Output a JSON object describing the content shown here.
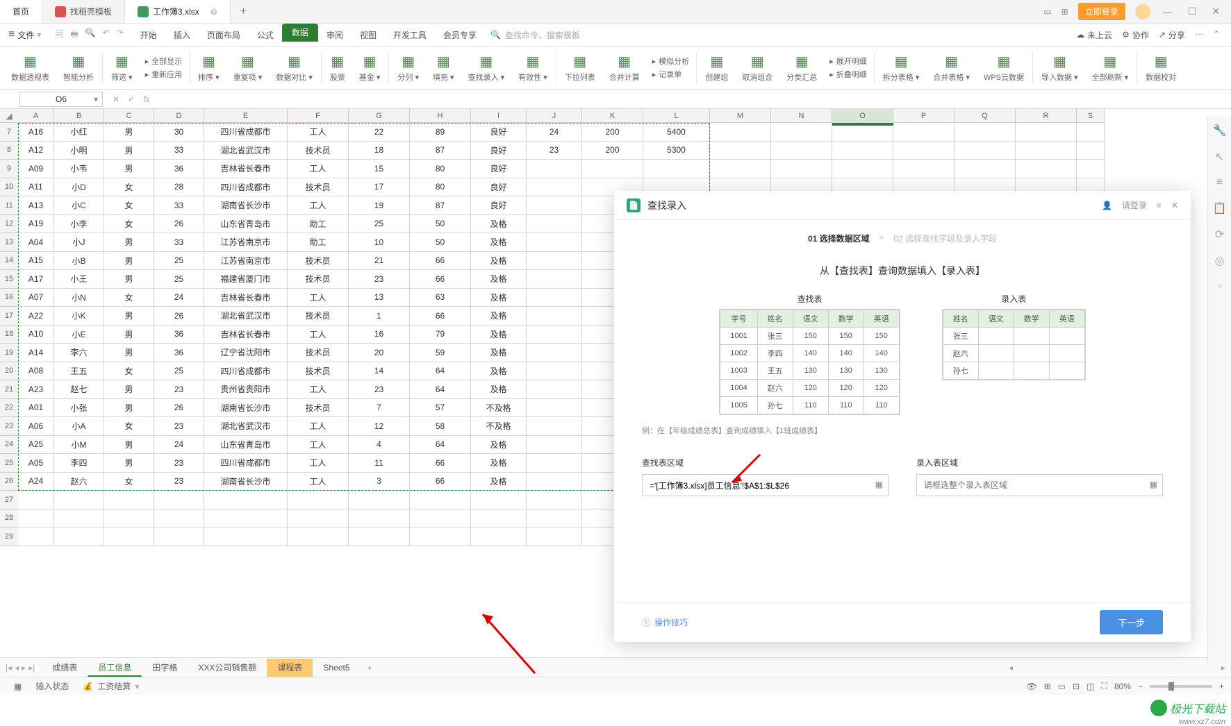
{
  "titlebar": {
    "home": "首页",
    "template": "找稻壳模板",
    "file_tab": "工作簿3.xlsx",
    "login": "立即登录"
  },
  "menubar": {
    "file": "文件",
    "items": [
      "开始",
      "插入",
      "页面布局",
      "公式",
      "数据",
      "审阅",
      "视图",
      "开发工具",
      "会员专享"
    ],
    "active_index": 4,
    "search_placeholder": "查找命令、搜索模板",
    "cloud": "未上云",
    "collab": "协作",
    "share": "分享"
  },
  "ribbon": {
    "groups": [
      "数据透视表",
      "智能分析",
      "筛选",
      "全部显示",
      "重新应用",
      "排序",
      "重复项",
      "数据对比",
      "股票",
      "基金",
      "分列",
      "填充",
      "查找录入",
      "有效性",
      "下拉列表",
      "合并计算",
      "模拟分析",
      "记录单",
      "创建组",
      "取消组合",
      "分类汇总",
      "展开明细",
      "折叠明细",
      "拆分表格",
      "合并表格",
      "WPS云数据",
      "导入数据",
      "全部刷新",
      "数据校对"
    ]
  },
  "formula": {
    "name_box": "O6",
    "fx": "fx"
  },
  "columns": [
    "A",
    "B",
    "C",
    "D",
    "E",
    "F",
    "G",
    "H",
    "I",
    "J",
    "K",
    "L",
    "M",
    "N",
    "O",
    "P",
    "Q",
    "R",
    "S"
  ],
  "row_start": 7,
  "rows": [
    [
      "A16",
      "小红",
      "男",
      "30",
      "四川省成都市",
      "工人",
      "22",
      "89",
      "良好",
      "24",
      "200",
      "5400"
    ],
    [
      "A12",
      "小明",
      "男",
      "33",
      "湖北省武汉市",
      "技术员",
      "18",
      "87",
      "良好",
      "23",
      "200",
      "5300"
    ],
    [
      "A09",
      "小韦",
      "男",
      "36",
      "吉林省长春市",
      "工人",
      "15",
      "80",
      "良好",
      "",
      "",
      ""
    ],
    [
      "A11",
      "小D",
      "女",
      "28",
      "四川省成都市",
      "技术员",
      "17",
      "80",
      "良好",
      "",
      "",
      ""
    ],
    [
      "A13",
      "小C",
      "女",
      "33",
      "湖南省长沙市",
      "工人",
      "19",
      "87",
      "良好",
      "",
      "",
      ""
    ],
    [
      "A19",
      "小李",
      "女",
      "26",
      "山东省青岛市",
      "助工",
      "25",
      "50",
      "及格",
      "",
      "",
      ""
    ],
    [
      "A04",
      "小J",
      "男",
      "33",
      "江苏省南京市",
      "助工",
      "10",
      "50",
      "及格",
      "",
      "",
      ""
    ],
    [
      "A15",
      "小B",
      "男",
      "25",
      "江苏省南京市",
      "技术员",
      "21",
      "66",
      "及格",
      "",
      "",
      ""
    ],
    [
      "A17",
      "小王",
      "男",
      "25",
      "福建省厦门市",
      "技术员",
      "23",
      "66",
      "及格",
      "",
      "",
      ""
    ],
    [
      "A07",
      "小N",
      "女",
      "24",
      "吉林省长春市",
      "工人",
      "13",
      "63",
      "及格",
      "",
      "",
      ""
    ],
    [
      "A22",
      "小K",
      "男",
      "26",
      "湖北省武汉市",
      "技术员",
      "1",
      "66",
      "及格",
      "",
      "",
      ""
    ],
    [
      "A10",
      "小E",
      "男",
      "36",
      "吉林省长春市",
      "工人",
      "16",
      "79",
      "及格",
      "",
      "",
      ""
    ],
    [
      "A14",
      "李六",
      "男",
      "36",
      "辽宁省沈阳市",
      "技术员",
      "20",
      "59",
      "及格",
      "",
      "",
      ""
    ],
    [
      "A08",
      "王五",
      "女",
      "25",
      "四川省成都市",
      "技术员",
      "14",
      "64",
      "及格",
      "",
      "",
      ""
    ],
    [
      "A23",
      "赵七",
      "男",
      "23",
      "贵州省贵阳市",
      "工人",
      "23",
      "64",
      "及格",
      "",
      "",
      ""
    ],
    [
      "A01",
      "小张",
      "男",
      "26",
      "湖南省长沙市",
      "技术员",
      "7",
      "57",
      "不及格",
      "",
      "",
      ""
    ],
    [
      "A06",
      "小A",
      "女",
      "23",
      "湖北省武汉市",
      "工人",
      "12",
      "58",
      "不及格",
      "",
      "",
      ""
    ],
    [
      "A25",
      "小M",
      "男",
      "24",
      "山东省青岛市",
      "工人",
      "4",
      "64",
      "及格",
      "",
      "",
      ""
    ],
    [
      "A05",
      "李四",
      "男",
      "23",
      "四川省成都市",
      "工人",
      "11",
      "66",
      "及格",
      "",
      "",
      ""
    ],
    [
      "A24",
      "赵六",
      "女",
      "23",
      "湖南省长沙市",
      "工人",
      "3",
      "66",
      "及格",
      "",
      "",
      ""
    ]
  ],
  "panel": {
    "title": "查找录入",
    "login_prompt": "请登录",
    "step1": "01 选择数据区域",
    "step2": "02 选择查找字段及录入字段",
    "diagram_title": "从【查找表】查询数据填入【录入表】",
    "lookup_table_title": "查找表",
    "entry_table_title": "录入表",
    "lookup_headers": [
      "学号",
      "姓名",
      "语文",
      "数学",
      "英语"
    ],
    "lookup_rows": [
      [
        "1001",
        "张三",
        "150",
        "150",
        "150"
      ],
      [
        "1002",
        "李四",
        "140",
        "140",
        "140"
      ],
      [
        "1003",
        "王五",
        "130",
        "130",
        "130"
      ],
      [
        "1004",
        "赵六",
        "120",
        "120",
        "120"
      ],
      [
        "1005",
        "孙七",
        "110",
        "110",
        "110"
      ]
    ],
    "entry_headers": [
      "姓名",
      "语文",
      "数学",
      "英语"
    ],
    "entry_rows": [
      [
        "张三",
        "",
        "",
        ""
      ],
      [
        "赵六",
        "",
        "",
        ""
      ],
      [
        "孙七",
        "",
        "",
        ""
      ]
    ],
    "example_note": "例：在【年级成绩总表】查询成绩填入【1班成绩表】",
    "lookup_area_label": "查找表区域",
    "entry_area_label": "录入表区域",
    "lookup_area_value": "='[工作簿3.xlsx]员工信息'!$A$1:$L$26",
    "entry_area_placeholder": "请框选整个录入表区域",
    "tips": "操作技巧",
    "next": "下一步"
  },
  "sheet_tabs": [
    "成绩表",
    "员工信息",
    "田字格",
    "XXX公司销售额",
    "课程表",
    "Sheet5"
  ],
  "active_sheet_index": 1,
  "orange_sheet_index": 4,
  "statusbar": {
    "mode": "输入状态",
    "salary": "工资结算",
    "zoom": "80%"
  },
  "watermark": "极光下载站",
  "watermark_url": "www.xz7.com"
}
